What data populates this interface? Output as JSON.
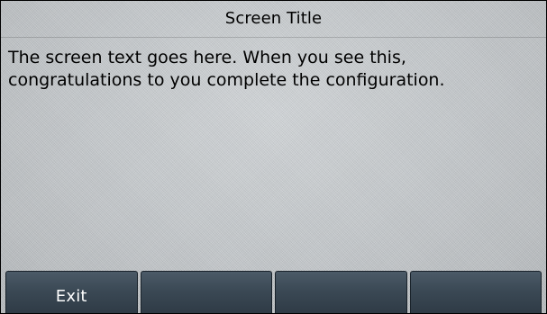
{
  "screen": {
    "title": "Screen Title",
    "text": "The screen text goes here. When you see this,\ncongratulations to you complete the configuration."
  },
  "softkeys": [
    {
      "label": "Exit"
    },
    {
      "label": ""
    },
    {
      "label": ""
    },
    {
      "label": ""
    }
  ]
}
